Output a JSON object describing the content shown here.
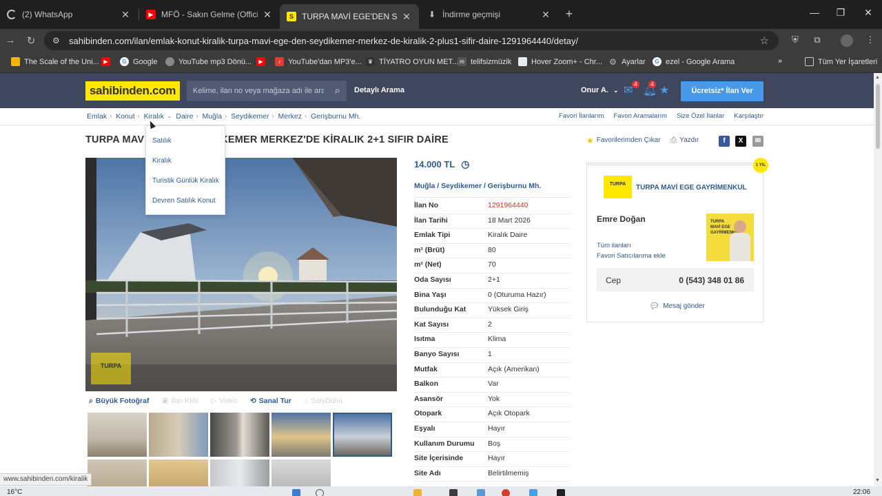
{
  "browser": {
    "tabs": [
      {
        "label": "(2) WhatsApp",
        "icon": "loading-icon",
        "color": "#c7c7c7"
      },
      {
        "label": "MFÖ - Sakın Gelme (Official Vid",
        "icon": "youtube-icon",
        "color": "#ff0000"
      },
      {
        "label": "TURPA MAVİ EGE'DEN SEYDİKE",
        "icon": "sahibinden-favicon",
        "color": "#ffe800",
        "active": true
      },
      {
        "label": "İndirme geçmişi",
        "icon": "download-icon",
        "color": "#c7c7c7"
      }
    ],
    "url": "sahibinden.com/ilan/emlak-konut-kiralik-turpa-mavi-ege-den-seydikemer-merkez-de-kiralik-2-plus1-sifir-daire-1291964440/detay/",
    "bookmarks": [
      {
        "label": "The Scale of the Uni...",
        "color": "#f5b400"
      },
      {
        "label": "",
        "color": "#ff0000"
      },
      {
        "label": "Google",
        "color": "#4285f4"
      },
      {
        "label": "YouTube mp3 Dönü...",
        "color": "#888888"
      },
      {
        "label": "",
        "color": "#ff0000"
      },
      {
        "label": "YouTube'dan MP3'e...",
        "color": "#e53935"
      },
      {
        "label": "TİYATRO OYUN MET...",
        "color": "#333333"
      },
      {
        "label": "telifsizmüzik",
        "color": "#555555"
      },
      {
        "label": "Hover Zoom+ - Chr...",
        "color": "#e8eaed"
      },
      {
        "label": "Ayarlar",
        "color": "#9e9e9e"
      },
      {
        "label": "ezel - Google Arama",
        "color": "#4285f4"
      }
    ],
    "all_bookmarks": "Tüm Yer İşaretleri"
  },
  "header": {
    "logo": "sahibinden.com",
    "search_placeholder": "Kelime, ilan no veya mağaza adı ile ara",
    "detailed_search": "Detaylı Arama",
    "user": "Onur A.",
    "messages_count": "4",
    "notifications_count": "4",
    "cta": "Ücretsiz* İlan Ver"
  },
  "breadcrumb": [
    "Emlak",
    "Konut",
    "Kiralık",
    "Daire",
    "Muğla",
    "Seydikemer",
    "Merkez",
    "Gerişburnu Mh."
  ],
  "right_links": [
    "Favori İlanlarım",
    "Favori Aramalarım",
    "Size Özel İlanlar",
    "Karşılaştır"
  ],
  "dropdown": [
    "Satılık",
    "Kiralık",
    "Turistik Günlük Kiralık",
    "Devren Satılık Konut"
  ],
  "listing": {
    "title": "TURPA MAVİ EGE'DEN SEYDİKEMER MERKEZ'DE KİRALIK 2+1 SIFIR DAİRE",
    "title_visible_left": "TURPA MAV",
    "title_visible_right": "DİKEMER MERKEZ'DE KİRALIK 2+1 SIFIR DAİRE",
    "favorite_action": "Favorilerimden Çıkar",
    "print_action": "Yazdır",
    "price": "14.000 TL",
    "location": "Muğla  /  Seydikemer  /  Gerişburnu Mh.",
    "details": [
      {
        "key": "İlan No",
        "value": "1291964440",
        "highlight": true
      },
      {
        "key": "İlan Tarihi",
        "value": "18 Mart 2026"
      },
      {
        "key": "Emlak Tipi",
        "value": "Kiralık Daire"
      },
      {
        "key": "m² (Brüt)",
        "value": "80"
      },
      {
        "key": "m² (Net)",
        "value": "70"
      },
      {
        "key": "Oda Sayısı",
        "value": "2+1"
      },
      {
        "key": "Bina Yaşı",
        "value": "0 (Oturuma Hazır)"
      },
      {
        "key": "Bulunduğu Kat",
        "value": "Yüksek Giriş"
      },
      {
        "key": "Kat Sayısı",
        "value": "2"
      },
      {
        "key": "Isıtma",
        "value": "Klima"
      },
      {
        "key": "Banyo Sayısı",
        "value": "1"
      },
      {
        "key": "Mutfak",
        "value": "Açık (Amerikan)"
      },
      {
        "key": "Balkon",
        "value": "Var"
      },
      {
        "key": "Asansör",
        "value": "Yok"
      },
      {
        "key": "Otopark",
        "value": "Açık Otopark"
      },
      {
        "key": "Eşyalı",
        "value": "Hayır"
      },
      {
        "key": "Kullanım Durumu",
        "value": "Boş"
      },
      {
        "key": "Site İçerisinde",
        "value": "Hayır"
      },
      {
        "key": "Site Adı",
        "value": "Belirtilmemiş"
      }
    ],
    "photo_tools": [
      {
        "label": "Büyük Fotoğraf",
        "icon": "magnifier-icon",
        "active": true
      },
      {
        "label": "Ilan Klibi",
        "icon": "clip-icon",
        "active": false
      },
      {
        "label": "Video",
        "icon": "play-icon",
        "active": false
      },
      {
        "label": "Sanal Tur",
        "icon": "virtual-tour-icon",
        "active": true
      },
      {
        "label": "SahiDaha",
        "icon": "home-icon",
        "active": false
      }
    ],
    "photo_watermark": "TURPA"
  },
  "seller": {
    "store_name": "TURPA MAVİ EGE GAYRİMENKUL",
    "logo_text": "TURPA",
    "badge": "1 YIL",
    "agent": "Emre Doğan",
    "link_all": "Tüm ilanları",
    "link_fav": "Favori Satıcılarıma ekle",
    "phone_label": "Cep",
    "phone": "0 (543) 348 01 86",
    "message": "Mesaj gönder",
    "photo_text": "TURPA MAVİ EGE GAYRİMENKUL"
  },
  "status_url": "www.sahibinden.com/kiralik",
  "taskbar": {
    "temperature": "16°C",
    "time": "22:06"
  },
  "colors": {
    "brand_yellow": "#ffe800",
    "header_bg": "#3f475f",
    "link_blue": "#2f5a8c",
    "cta_blue": "#489ae9",
    "ilan_no_red": "#c0392b"
  }
}
